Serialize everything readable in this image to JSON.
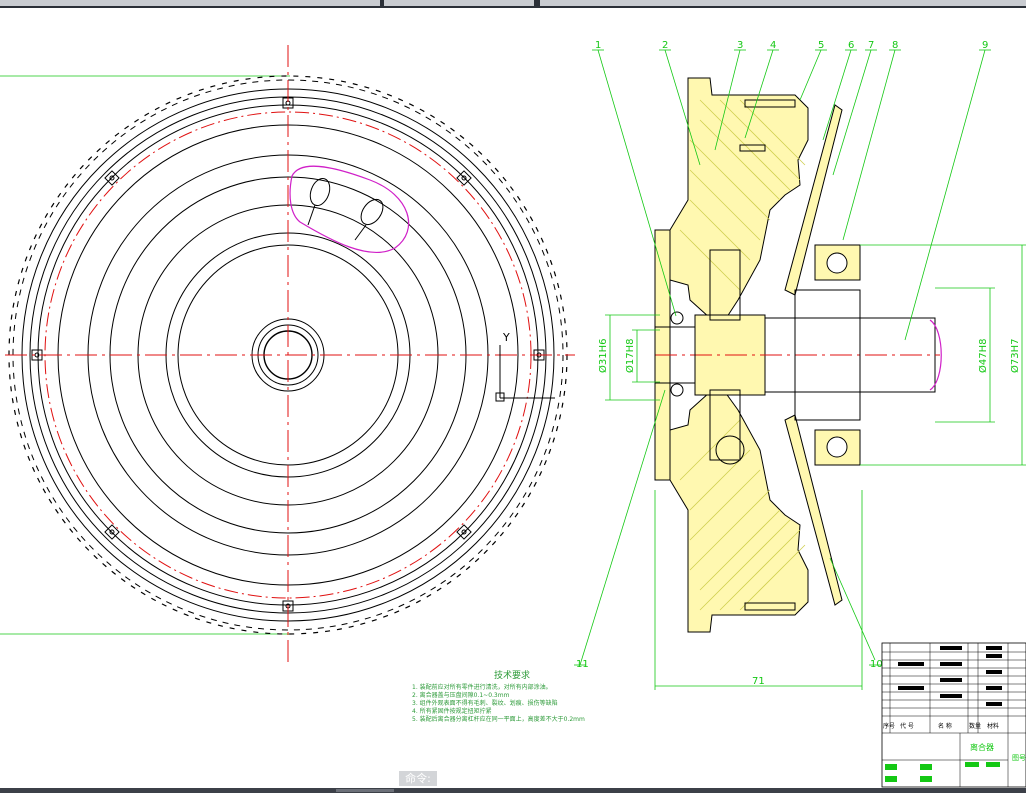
{
  "drawing": {
    "part_labels": [
      "1",
      "2",
      "3",
      "4",
      "5",
      "6",
      "7",
      "8",
      "9",
      "10",
      "11"
    ],
    "dimensions": {
      "d_left_bore": "Ø31H6",
      "d_center_bore": "Ø17H8",
      "d_shaft": "Ø47H8",
      "d_outer_bore": "Ø73H7",
      "width": "71"
    },
    "ucs_label": "Y",
    "notes_title": "技术要求",
    "notes": [
      "1. 装配前应对所有零件进行清洗，对所有内部涂油。",
      "2. 离合器盖与压盘间隙0.1~0.3mm",
      "3. 组件外观表面不得有毛刺、裂纹、划痕、损伤等缺陷",
      "4. 所有紧固件按规定扭矩拧紧",
      "5. 装配后离合器分离杠杆应在同一平面上，高度差不大于0.2mm"
    ],
    "title_block": {
      "drawing_name": "离合器",
      "header_cells": [
        "序号",
        "代 号",
        "名 称",
        "数量",
        "材料"
      ],
      "right_label": "图号"
    }
  },
  "command_line": {
    "label": "命令:"
  },
  "colors": {
    "outline": "#000000",
    "center_line": "#e01010",
    "leader": "#14c814",
    "dimension": "#14c814",
    "section_fill": "#fff8b0",
    "hatch": "#cfcf50",
    "highlight": "#d020c8",
    "canvas": "#ffffff"
  }
}
